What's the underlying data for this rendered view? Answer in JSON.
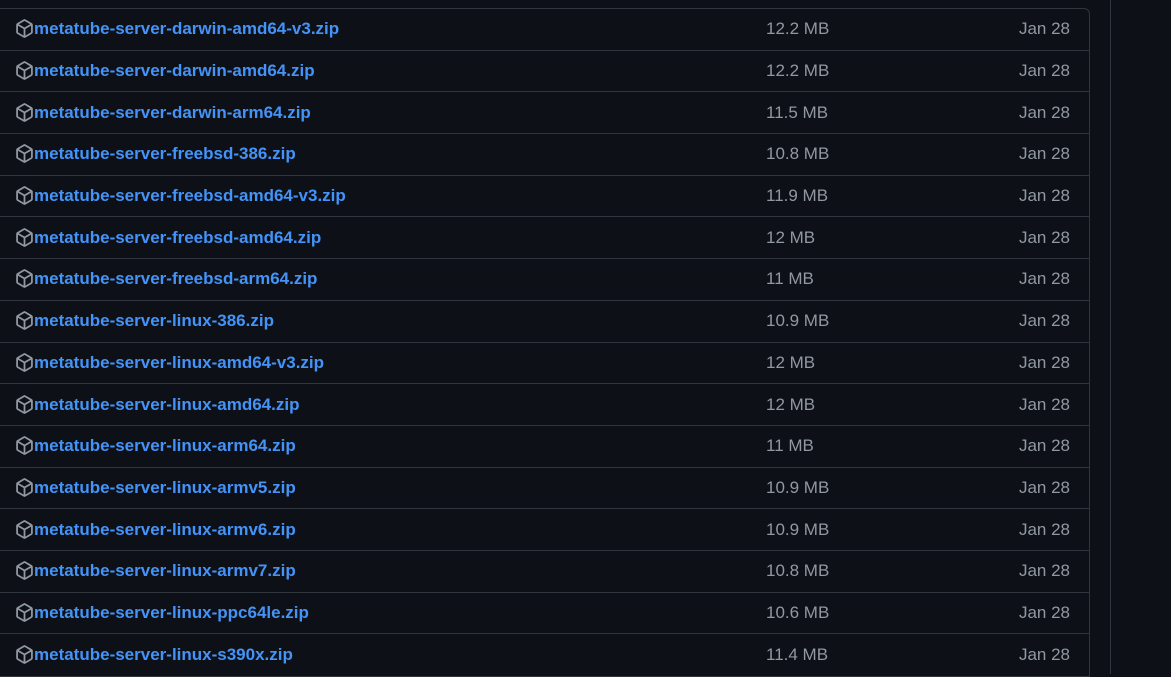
{
  "colors": {
    "background": "#0d1117",
    "link": "#4493f8",
    "muted": "#9198a1",
    "border": "#30363d"
  },
  "asset_icon": "package-icon",
  "assets": [
    {
      "name": "metatube-server-darwin-amd64-v3.zip",
      "size": "12.2 MB",
      "date": "Jan 28"
    },
    {
      "name": "metatube-server-darwin-amd64.zip",
      "size": "12.2 MB",
      "date": "Jan 28"
    },
    {
      "name": "metatube-server-darwin-arm64.zip",
      "size": "11.5 MB",
      "date": "Jan 28"
    },
    {
      "name": "metatube-server-freebsd-386.zip",
      "size": "10.8 MB",
      "date": "Jan 28"
    },
    {
      "name": "metatube-server-freebsd-amd64-v3.zip",
      "size": "11.9 MB",
      "date": "Jan 28"
    },
    {
      "name": "metatube-server-freebsd-amd64.zip",
      "size": "12 MB",
      "date": "Jan 28"
    },
    {
      "name": "metatube-server-freebsd-arm64.zip",
      "size": "11 MB",
      "date": "Jan 28"
    },
    {
      "name": "metatube-server-linux-386.zip",
      "size": "10.9 MB",
      "date": "Jan 28"
    },
    {
      "name": "metatube-server-linux-amd64-v3.zip",
      "size": "12 MB",
      "date": "Jan 28"
    },
    {
      "name": "metatube-server-linux-amd64.zip",
      "size": "12 MB",
      "date": "Jan 28"
    },
    {
      "name": "metatube-server-linux-arm64.zip",
      "size": "11 MB",
      "date": "Jan 28"
    },
    {
      "name": "metatube-server-linux-armv5.zip",
      "size": "10.9 MB",
      "date": "Jan 28"
    },
    {
      "name": "metatube-server-linux-armv6.zip",
      "size": "10.9 MB",
      "date": "Jan 28"
    },
    {
      "name": "metatube-server-linux-armv7.zip",
      "size": "10.8 MB",
      "date": "Jan 28"
    },
    {
      "name": "metatube-server-linux-ppc64le.zip",
      "size": "10.6 MB",
      "date": "Jan 28"
    },
    {
      "name": "metatube-server-linux-s390x.zip",
      "size": "11.4 MB",
      "date": "Jan 28"
    }
  ]
}
